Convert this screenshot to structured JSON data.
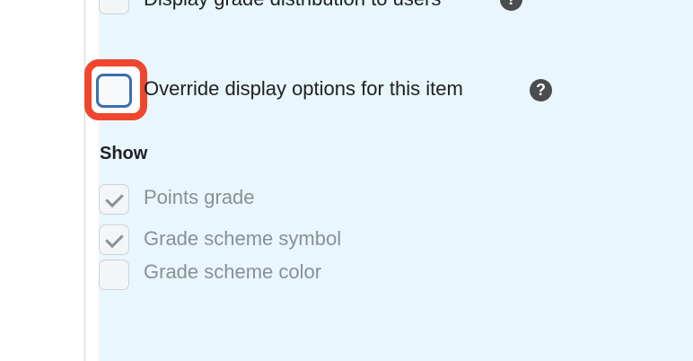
{
  "top_option": {
    "label": "Display grade distribution to users",
    "help_icon": "question-circle-icon"
  },
  "override": {
    "label": "Override display options for this item",
    "checked": false,
    "help_icon": "question-circle-icon",
    "highlight_color": "#f0462d",
    "focus_color": "#3a6fac"
  },
  "show_section": {
    "heading": "Show",
    "options": [
      {
        "label": "Points grade",
        "checked": true
      },
      {
        "label": "Grade scheme symbol",
        "checked": true
      },
      {
        "label": "Grade scheme color",
        "checked": false
      }
    ]
  },
  "colors": {
    "panel_background": "#e9f6fd",
    "disabled_text": "#8b8f93"
  }
}
